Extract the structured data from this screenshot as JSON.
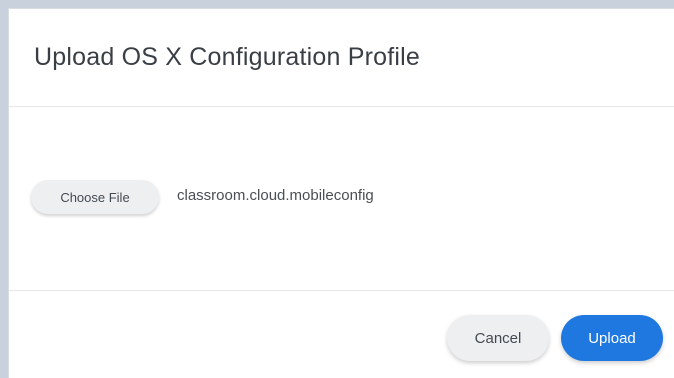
{
  "dialog": {
    "title": "Upload OS X Configuration Profile"
  },
  "file_picker": {
    "choose_label": "Choose File",
    "file_name": "classroom.cloud.mobileconfig"
  },
  "actions": {
    "cancel_label": "Cancel",
    "upload_label": "Upload"
  },
  "colors": {
    "accent": "#1f78e0",
    "secondary_button": "#eeeff1"
  }
}
